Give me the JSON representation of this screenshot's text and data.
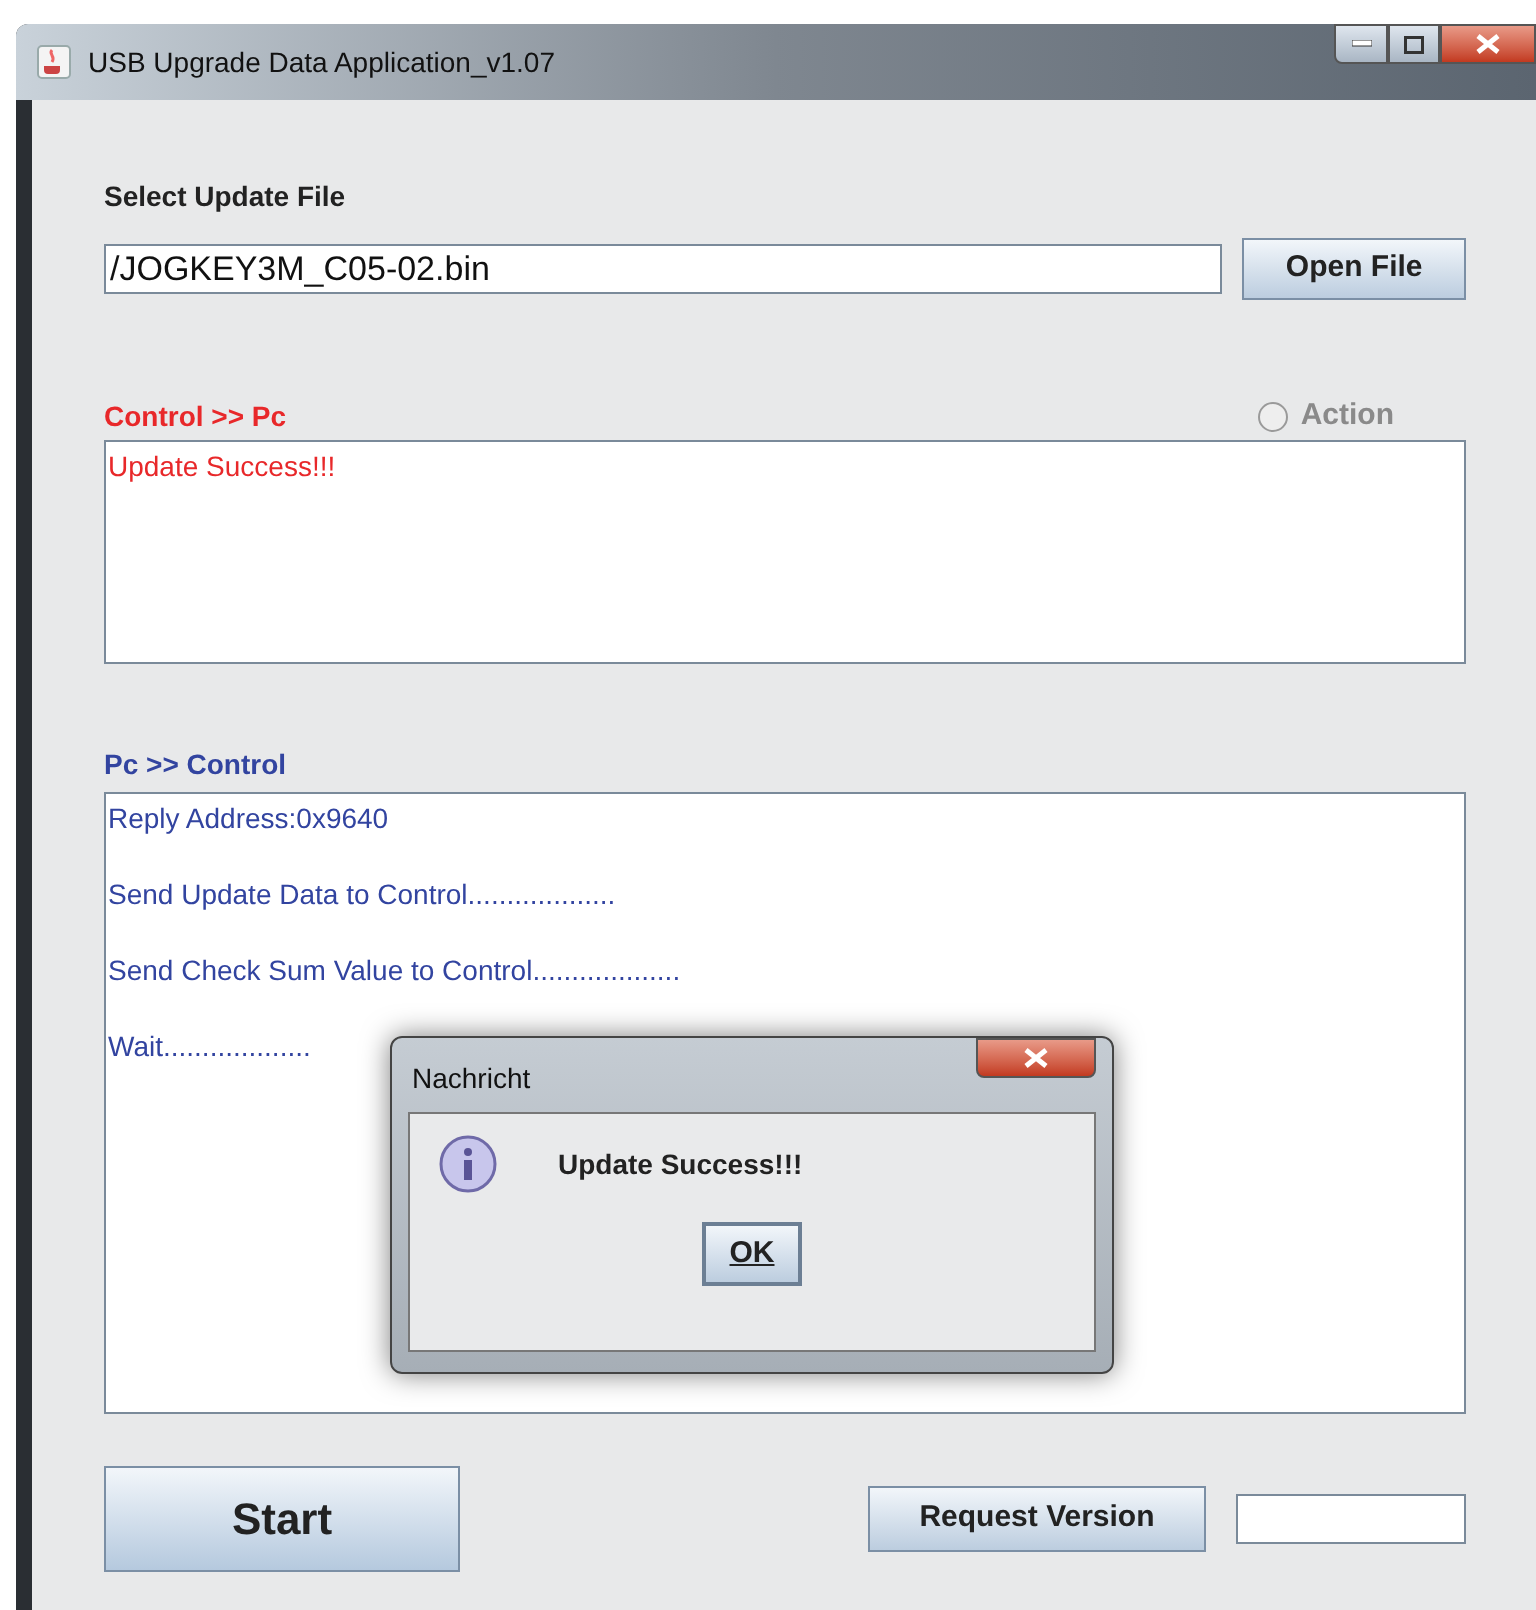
{
  "window": {
    "title": "USB Upgrade Data Application_v1.07"
  },
  "file_section": {
    "label": "Select Update File",
    "path": "/JOGKEY3M_C05-02.bin",
    "button": "Open File"
  },
  "control_to_pc": {
    "label": "Control >> Pc",
    "action": {
      "label": "Action",
      "selected": false,
      "disabled": true
    },
    "lines": [
      "Update Success!!!"
    ]
  },
  "pc_to_control": {
    "label": "Pc >> Control",
    "lines": [
      "Reply Address:0x9640",
      "Send Update Data to Control...................",
      "Send Check Sum Value to Control...................",
      "Wait..................."
    ]
  },
  "buttons": {
    "start": "Start",
    "request_version": "Request Version"
  },
  "dialog": {
    "title": "Nachricht",
    "message": "Update Success!!!",
    "ok": "OK"
  }
}
